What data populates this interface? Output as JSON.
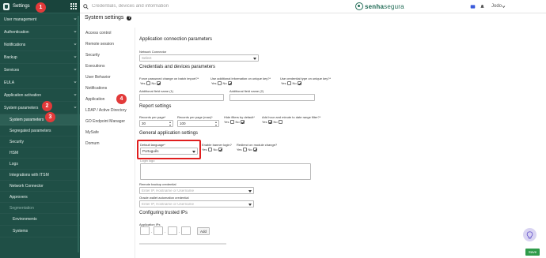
{
  "app": {
    "title": "Settings",
    "brand": "senhasegura",
    "brand_prefix": "senha",
    "brand_suffix": "segura",
    "user": "Jodo",
    "search_placeholder": "Credentials, devices and information"
  },
  "sidebar": {
    "items": [
      {
        "label": "User management",
        "name": "sidebar-item-user-management"
      },
      {
        "label": "Authentication",
        "name": "sidebar-item-authentication"
      },
      {
        "label": "Notifications",
        "name": "sidebar-item-notifications"
      },
      {
        "label": "Backup",
        "name": "sidebar-item-backup"
      },
      {
        "label": "Services",
        "name": "sidebar-item-services"
      },
      {
        "label": "EULA",
        "name": "sidebar-item-eula"
      },
      {
        "label": "Application activation",
        "name": "sidebar-item-application-activation"
      },
      {
        "label": "System parameters",
        "name": "sidebar-item-system-parameters"
      }
    ],
    "subitems": [
      {
        "label": "System parameters",
        "name": "sidebar-subitem-system-parameters"
      },
      {
        "label": "Segregated parameters",
        "name": "sidebar-subitem-segregated-parameters"
      },
      {
        "label": "Security",
        "name": "sidebar-subitem-security"
      },
      {
        "label": "HSM",
        "name": "sidebar-subitem-hsm"
      },
      {
        "label": "Logs",
        "name": "sidebar-subitem-logs"
      },
      {
        "label": "Integrations with ITSM",
        "name": "sidebar-subitem-integrations-itsm"
      },
      {
        "label": "Network Connector",
        "name": "sidebar-subitem-network-connector"
      },
      {
        "label": "Approvers",
        "name": "sidebar-subitem-approvers"
      },
      {
        "label": "Segmentation",
        "name": "sidebar-subitem-segmentation"
      }
    ],
    "subsubitems": [
      {
        "label": "Environments",
        "name": "sidebar-subsub-environments"
      },
      {
        "label": "Systems",
        "name": "sidebar-subsub-systems"
      }
    ]
  },
  "badges": {
    "one": "1",
    "two": "2",
    "three": "3",
    "four": "4"
  },
  "page": {
    "title": "System settings",
    "help": "?"
  },
  "settings_menu": [
    "Access control",
    "Remote session",
    "Security",
    "Executions",
    "User Behavior",
    "Notifications",
    "Application",
    "LDAP / Active Directory",
    "GO Endpoint Manager",
    "MySafe",
    "Domum"
  ],
  "form": {
    "s_app_conn": "Application connection parameters",
    "network_connector_label": "Network Connector",
    "network_connector_value": "Select",
    "s_cred_devices": "Credentials and devices parameters",
    "force_pwd_label": "Force password change on batch import?*",
    "use_additional_label": "Use additional information on unique key?*",
    "use_credential_type_label": "Use credential type on unique key?*",
    "yes": "Yes",
    "no": "No",
    "additional_field_1": "Additional field name (1)",
    "additional_field_2": "Additional field name (2)",
    "s_report": "Report settings",
    "records_label": "Records per page*",
    "records_value": "30",
    "records_max_label": "Records per page (max)*",
    "records_max_value": "100",
    "hide_filters_label": "Hide filters by default*",
    "add_hour_label": "Add hour and minute to date range filter?*",
    "s_general": "General application settings",
    "default_language_label": "Default language*",
    "default_language_value": "Português",
    "banner_label": "Enable banner login?",
    "redirect_label": "Redirect on module change?",
    "login_logo_label": "Login logo",
    "remote_backup_label": "Remote backup credential",
    "remote_backup_placeholder": "Enter IP, Hostname or Username",
    "oracle_label": "Oracle wallet automation credential",
    "oracle_placeholder": "Enter IP, Hostname or Username",
    "s_trusted": "Configuring trusted IPs",
    "app_ips_label": "Application IPs",
    "ip_dot": ".",
    "add_button": "Add",
    "save_button": "Save"
  },
  "colors": {
    "sidebar": "#1f4f46",
    "badge": "#e23a3a",
    "highlight": "#e01e1e",
    "save": "#2f9b4a",
    "brand": "#1f6a54"
  }
}
